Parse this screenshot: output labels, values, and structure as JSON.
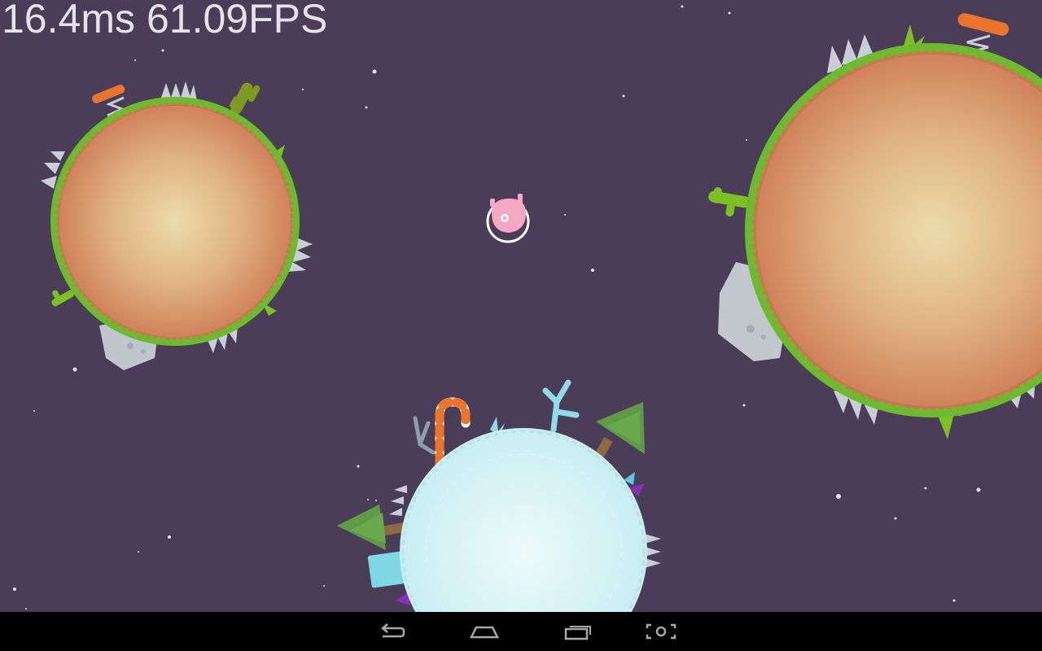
{
  "hud": {
    "frame_time": "16.4ms",
    "fps": "61.09FPS"
  },
  "colors": {
    "space": "#4a3d58",
    "grass": "#6dba2e",
    "desert_center": "#e8d2a0",
    "desert_edge": "#d4875a",
    "ice_center": "#eaf8f8",
    "ice_edge": "#c5ecf0",
    "spring": "#e8742e",
    "spike": "#c9ced6"
  },
  "navigation": {
    "back": "back-icon",
    "home": "home-icon",
    "recents": "recents-icon",
    "screenshot": "screenshot-icon"
  }
}
